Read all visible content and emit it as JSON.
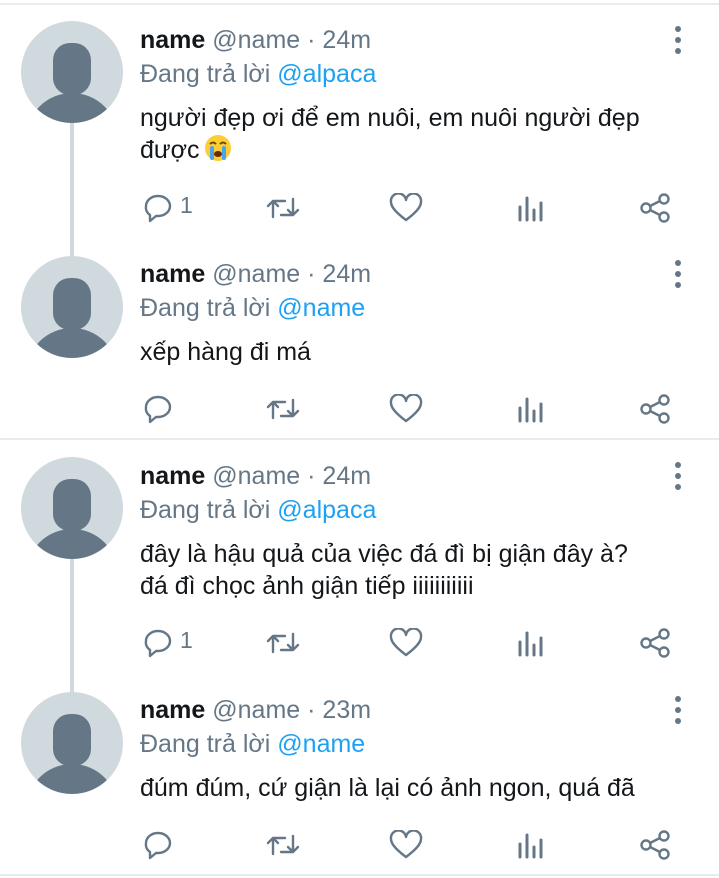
{
  "theme": {
    "text": "#14171a",
    "secondary": "#657786",
    "link": "#1da1f2",
    "avatar_bg": "#cfd9de",
    "avatar_fg": "#657786",
    "divider": "#e6ecf0"
  },
  "tweets": [
    {
      "name": "name",
      "handle": "@name",
      "sep": "·",
      "time": "24m",
      "reply_prefix": "Đang trả lời",
      "reply_to": "@alpaca",
      "text_line1": "người đẹp ơi để em nuôi, em nuôi người đẹp",
      "text_line2": "được",
      "emoji": "crying-face",
      "reply_count": "1"
    },
    {
      "name": "name",
      "handle": "@name",
      "sep": "·",
      "time": "24m",
      "reply_prefix": "Đang trả lời",
      "reply_to": "@name",
      "text_line1": "xếp hàng đi má",
      "reply_count": ""
    },
    {
      "name": "name",
      "handle": "@name",
      "sep": "·",
      "time": "24m",
      "reply_prefix": "Đang trả lời",
      "reply_to": "@alpaca",
      "text_line1": "đây là hậu quả của việc đá đì bị giận đây à?",
      "text_line2": "đá đì chọc ảnh giận tiếp iiiiiiiiiii",
      "reply_count": "1"
    },
    {
      "name": "name",
      "handle": "@name",
      "sep": "·",
      "time": "23m",
      "reply_prefix": "Đang trả lời",
      "reply_to": "@name",
      "text_line1": "đúm đúm, cứ giận là lại có ảnh ngon, quá đã",
      "reply_count": ""
    }
  ],
  "icons": {
    "reply": "reply-icon",
    "retweet": "retweet-icon",
    "like": "like-icon",
    "analytics": "analytics-icon",
    "share": "share-icon",
    "more": "more-vert-icon"
  }
}
